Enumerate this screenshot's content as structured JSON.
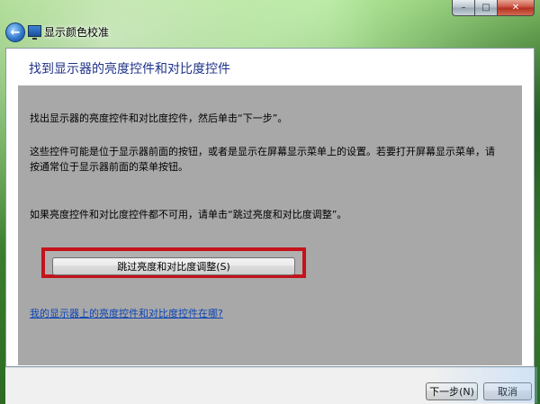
{
  "window": {
    "title": "显示颜色校准",
    "caption": {
      "minimize": "–",
      "maximize": "□",
      "close": "✕"
    }
  },
  "header": {
    "title": "找到显示器的亮度控件和对比度控件"
  },
  "body": {
    "para1": "找出显示器的亮度控件和对比度控件，然后单击“下一步”。",
    "para2": "这些控件可能是位于显示器前面的按钮，或者是显示在屏幕显示菜单上的设置。若要打开屏幕显示菜单，请按通常位于显示器前面的菜单按钮。",
    "para3": "如果亮度控件和对比度控件都不可用，请单击“跳过亮度和对比度调整”。",
    "skip_button": "跳过亮度和对比度调整(S)",
    "help_link": "我的显示器上的亮度控件和对比度控件在哪?"
  },
  "footer": {
    "next_label": "下一步(N)",
    "cancel_label": "取消"
  },
  "colors": {
    "highlight": "#c4131b",
    "link": "#0a44b5",
    "header_text": "#1e3287",
    "panel_gray": "#a8a8a8"
  },
  "icons": {
    "back": "back-arrow-icon",
    "app": "monitor-icon"
  }
}
